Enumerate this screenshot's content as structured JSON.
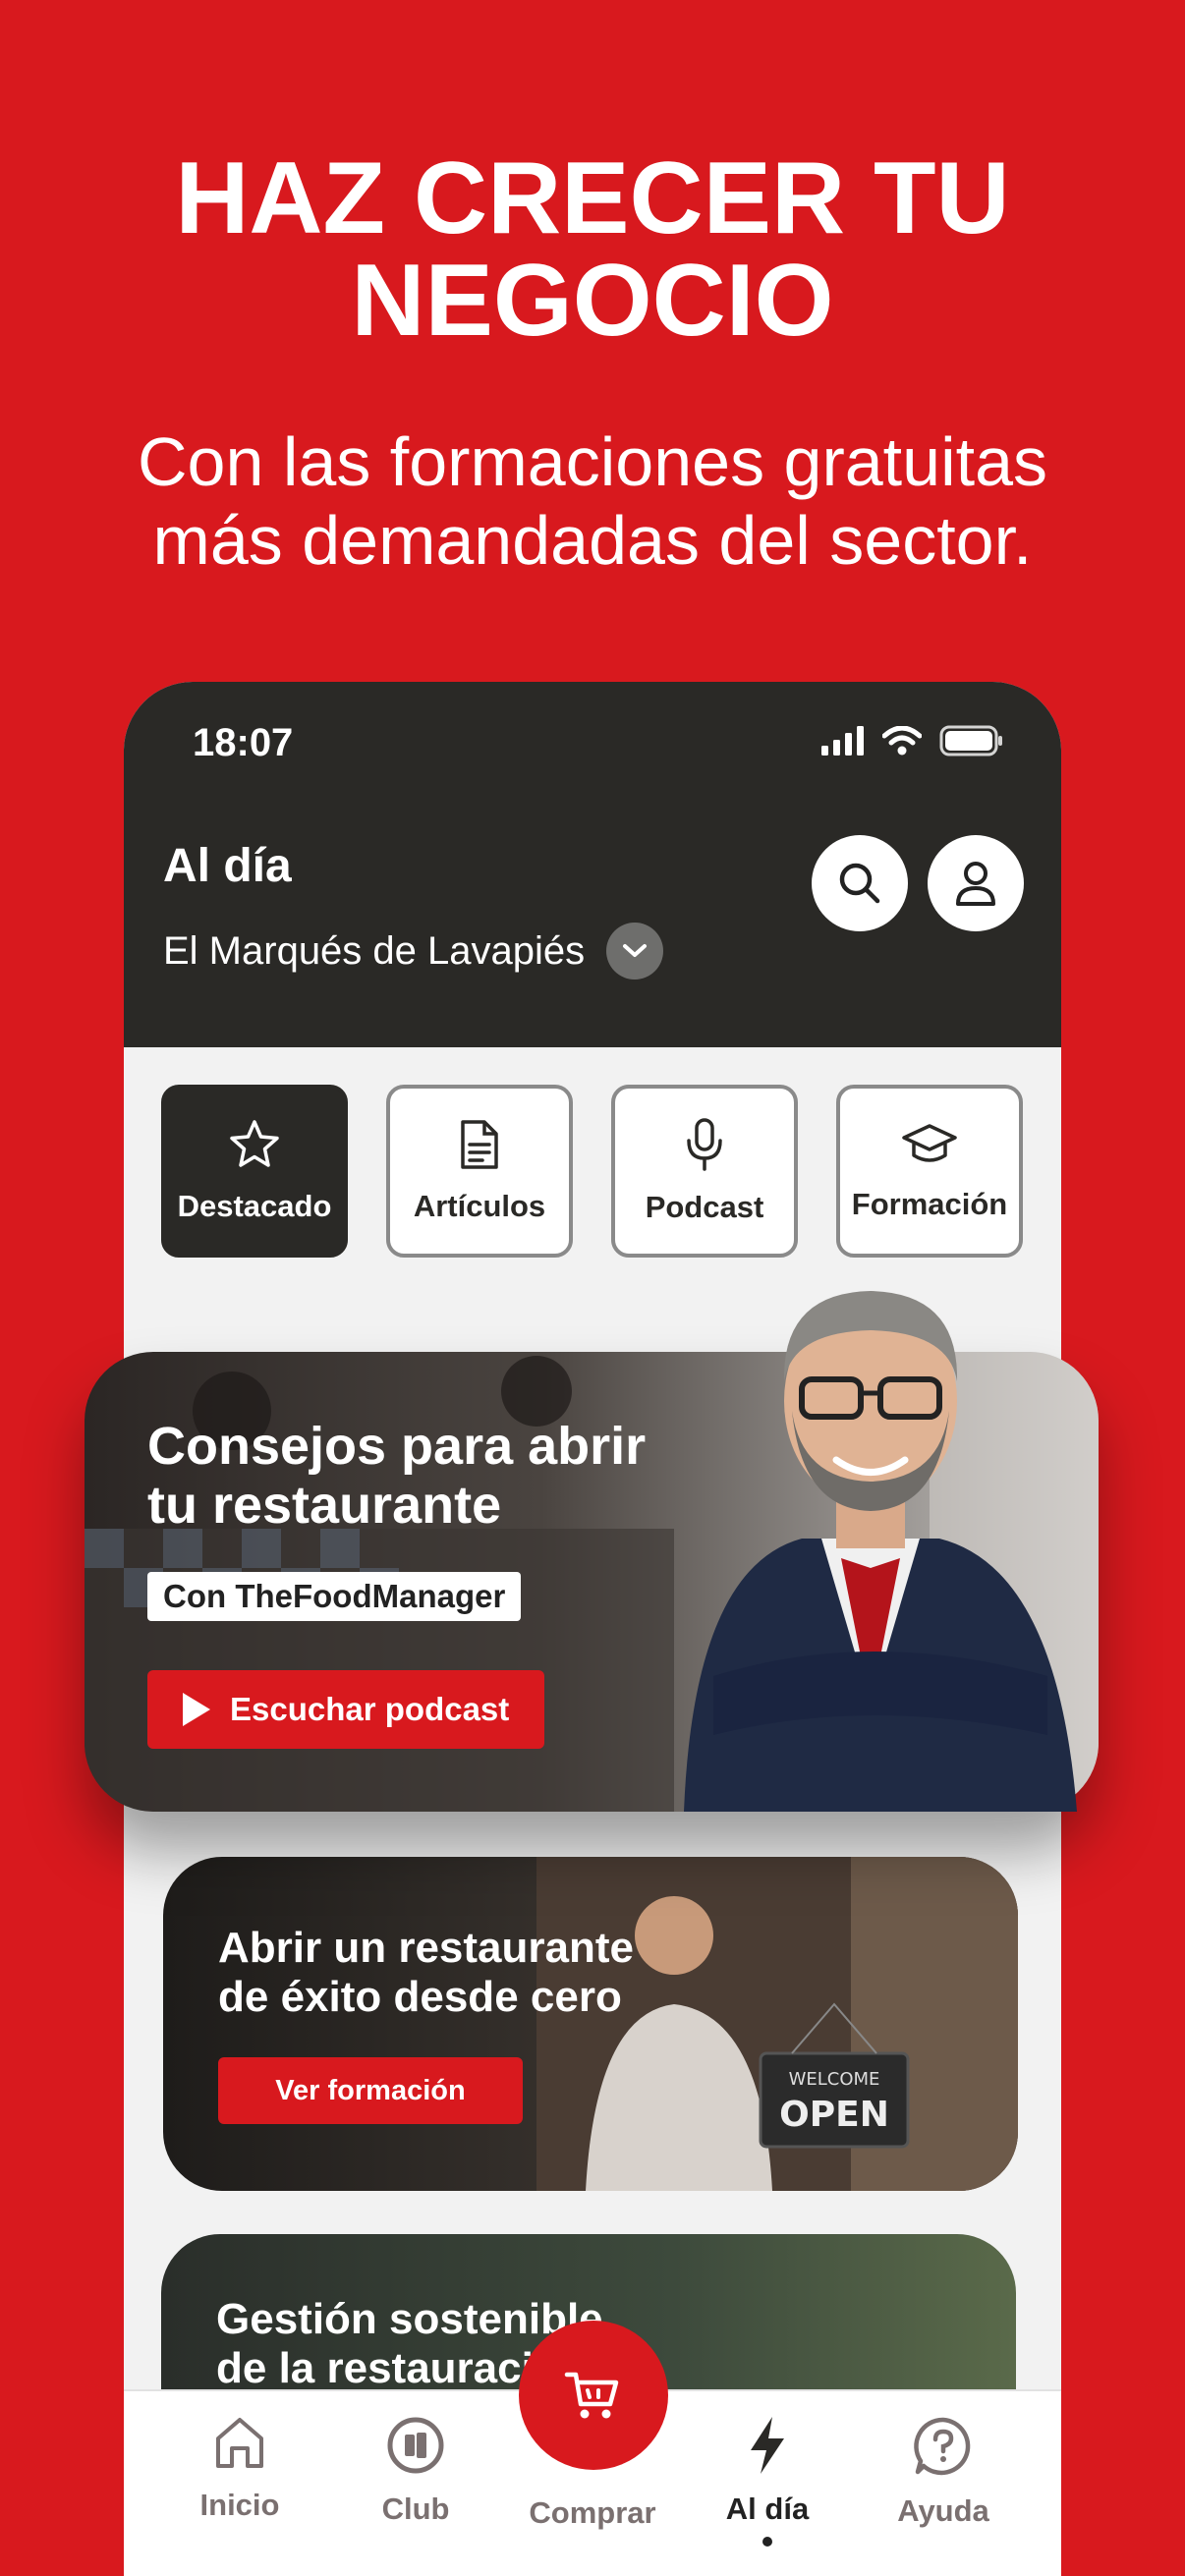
{
  "promo": {
    "title_line1": "HAZ CRECER TU",
    "title_line2": "NEGOCIO",
    "subtitle_line1": "Con las formaciones gratuitas",
    "subtitle_line2": "más demandadas del sector."
  },
  "status_bar": {
    "time": "18:07"
  },
  "header": {
    "title": "Al día",
    "location": "El Marqués de Lavapiés"
  },
  "categories": [
    {
      "label": "Destacado",
      "icon": "star-icon",
      "active": true
    },
    {
      "label": "Artículos",
      "icon": "document-icon",
      "active": false
    },
    {
      "label": "Podcast",
      "icon": "microphone-icon",
      "active": false
    },
    {
      "label": "Formación",
      "icon": "graduation-cap-icon",
      "active": false
    }
  ],
  "hero": {
    "title_line1": "Consejos para abrir",
    "title_line2": "tu restaurante",
    "tag": "Con TheFoodManager",
    "button": "Escuchar podcast"
  },
  "cards": [
    {
      "title_line1": "Abrir un restaurante",
      "title_line2": "de éxito desde cero",
      "button": "Ver formación",
      "sign_line1": "WELCOME",
      "sign_line2": "OPEN"
    },
    {
      "title_line1": "Gestión sostenible",
      "title_line2": "de la restauración"
    }
  ],
  "tabbar": [
    {
      "label": "Inicio",
      "icon": "home-icon"
    },
    {
      "label": "Club",
      "icon": "club-icon"
    },
    {
      "label": "Comprar",
      "icon": "cart-icon"
    },
    {
      "label": "Al día",
      "icon": "bolt-icon",
      "active": true
    },
    {
      "label": "Ayuda",
      "icon": "help-icon"
    }
  ],
  "colors": {
    "brand_red": "#d8191e",
    "header_dark": "#2a2926"
  }
}
